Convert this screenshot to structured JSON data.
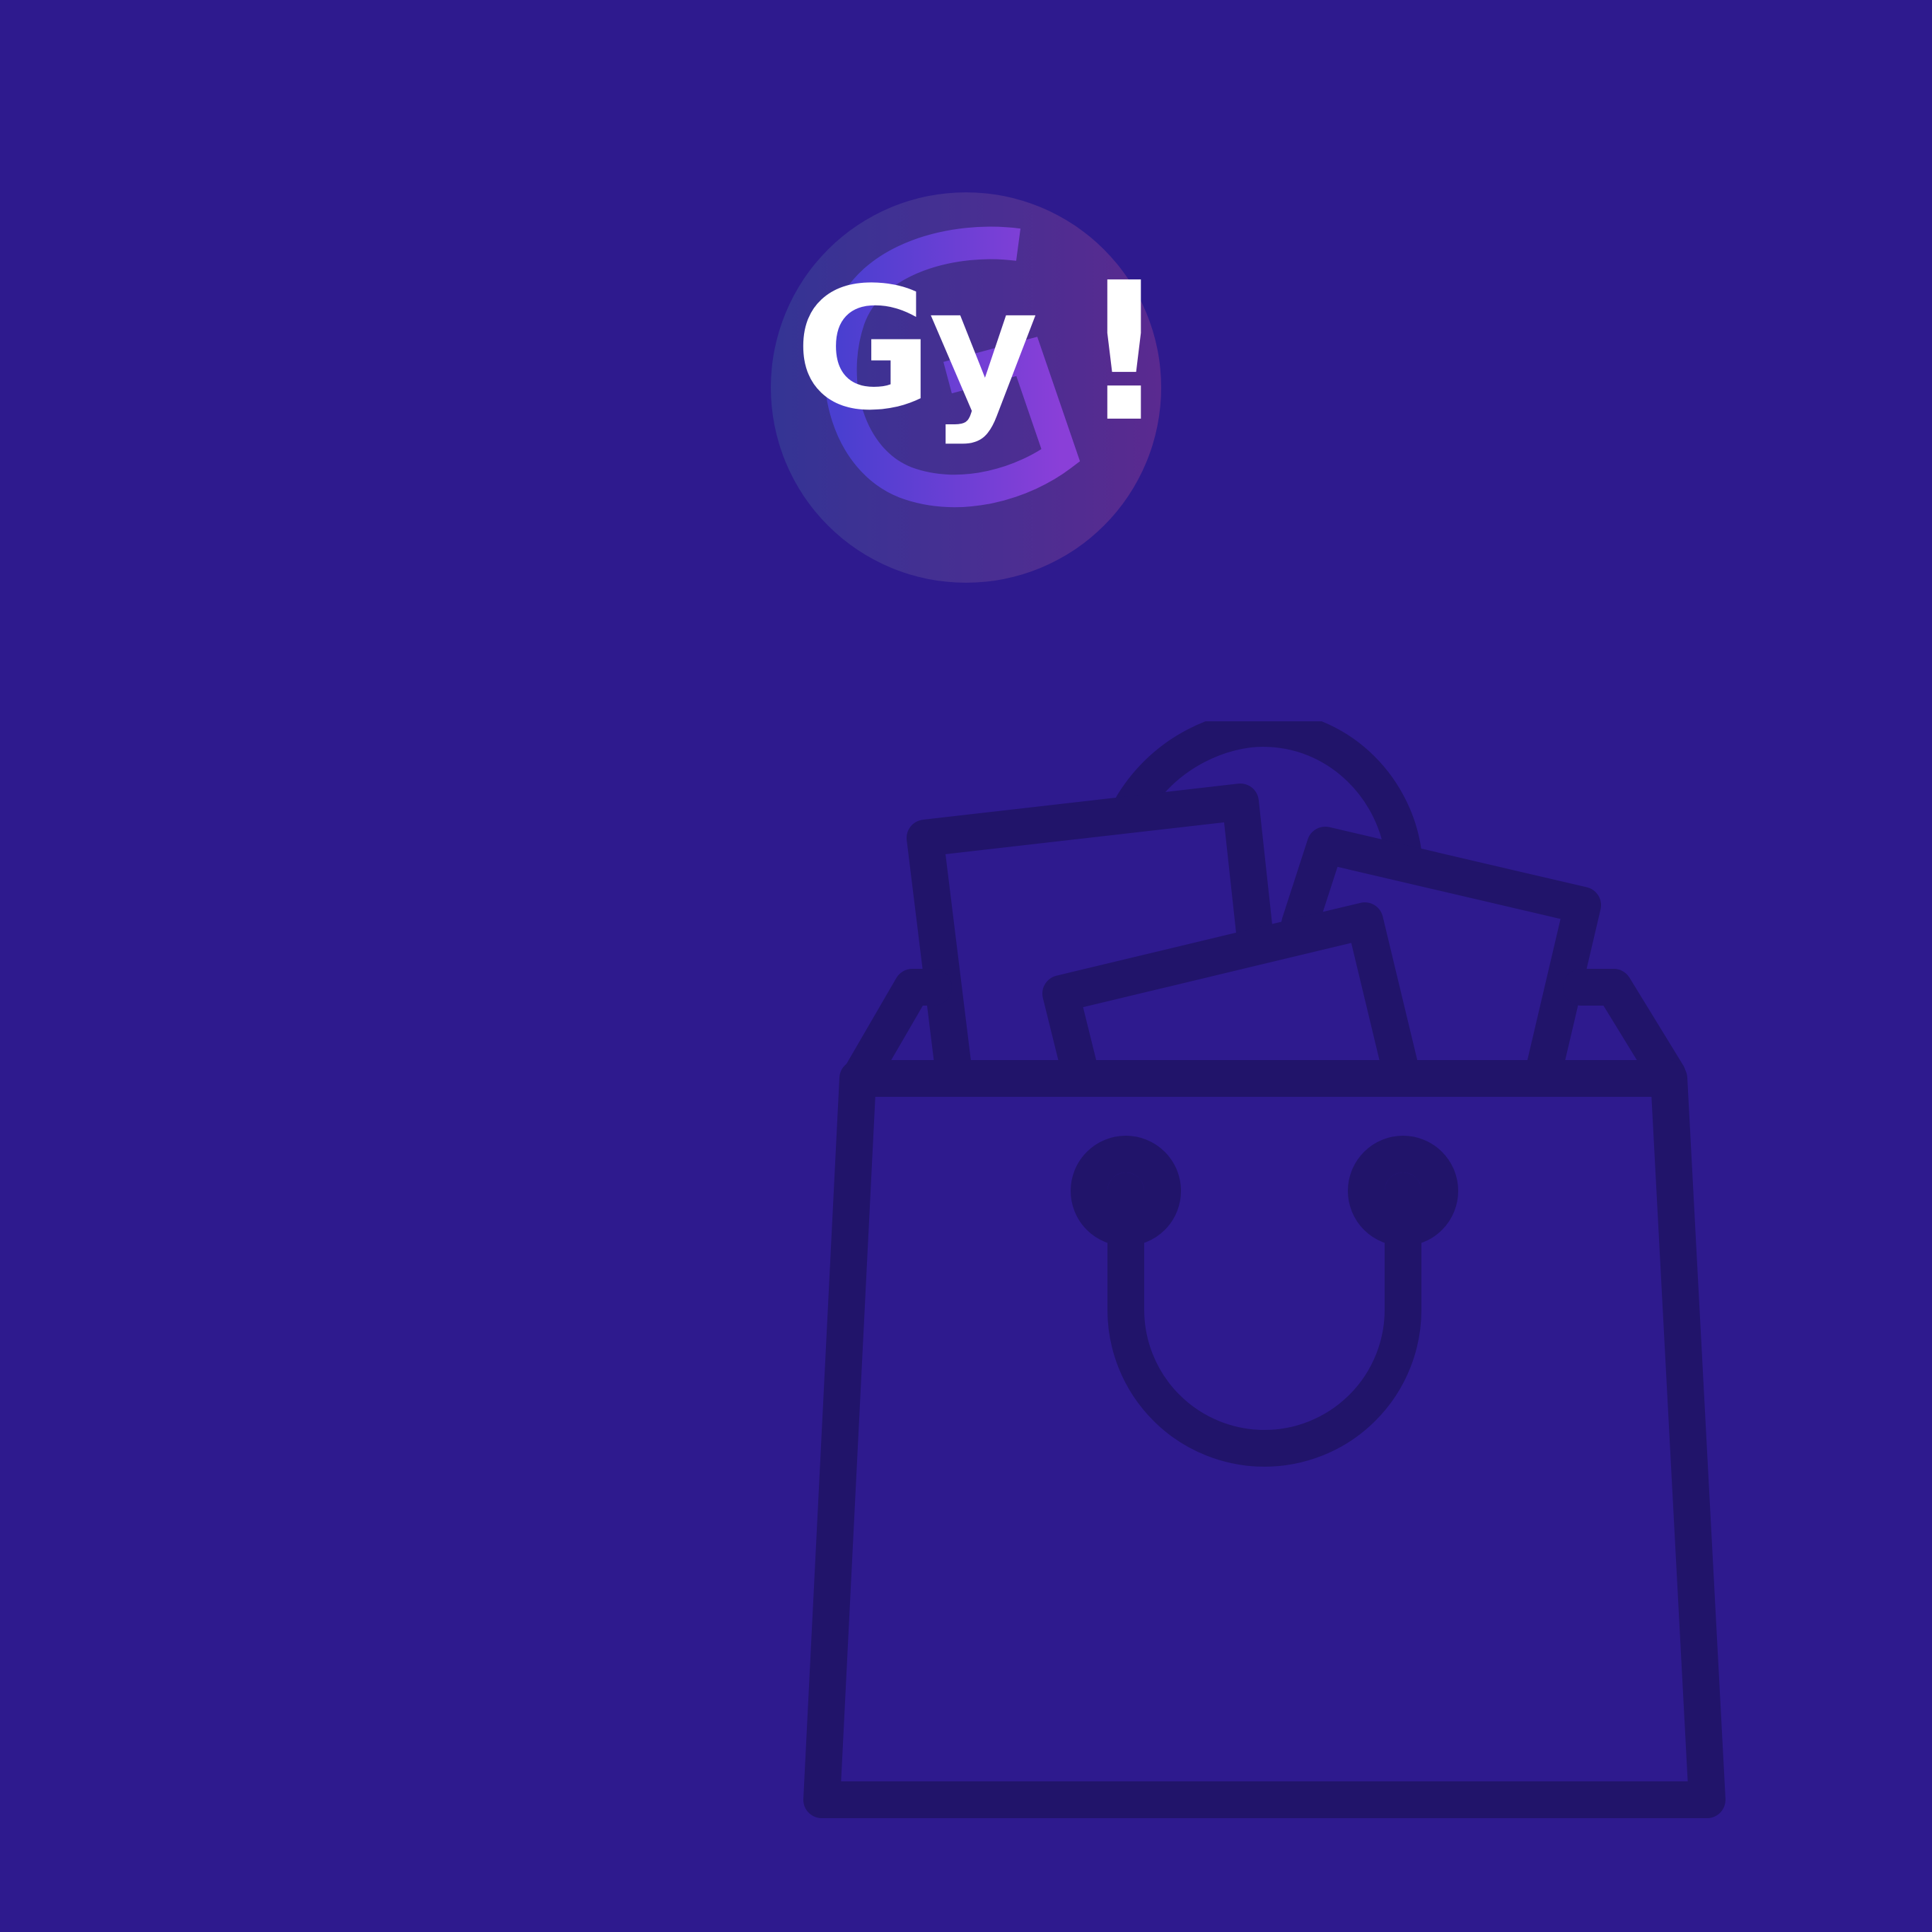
{
  "brand": {
    "logo_text": "Gy",
    "logo_exclaim": "!",
    "colors": {
      "background": "#2e1a8e",
      "logo_gradient_start": "#343494",
      "logo_gradient_end": "#5a2a90",
      "logo_swoosh_start": "#4a3fd0",
      "logo_swoosh_end": "#8a3fd8",
      "logo_text": "#ffffff",
      "bag_stroke": "#21146a"
    }
  },
  "illustration": {
    "icon": "shopping-bag-with-papers-icon"
  }
}
